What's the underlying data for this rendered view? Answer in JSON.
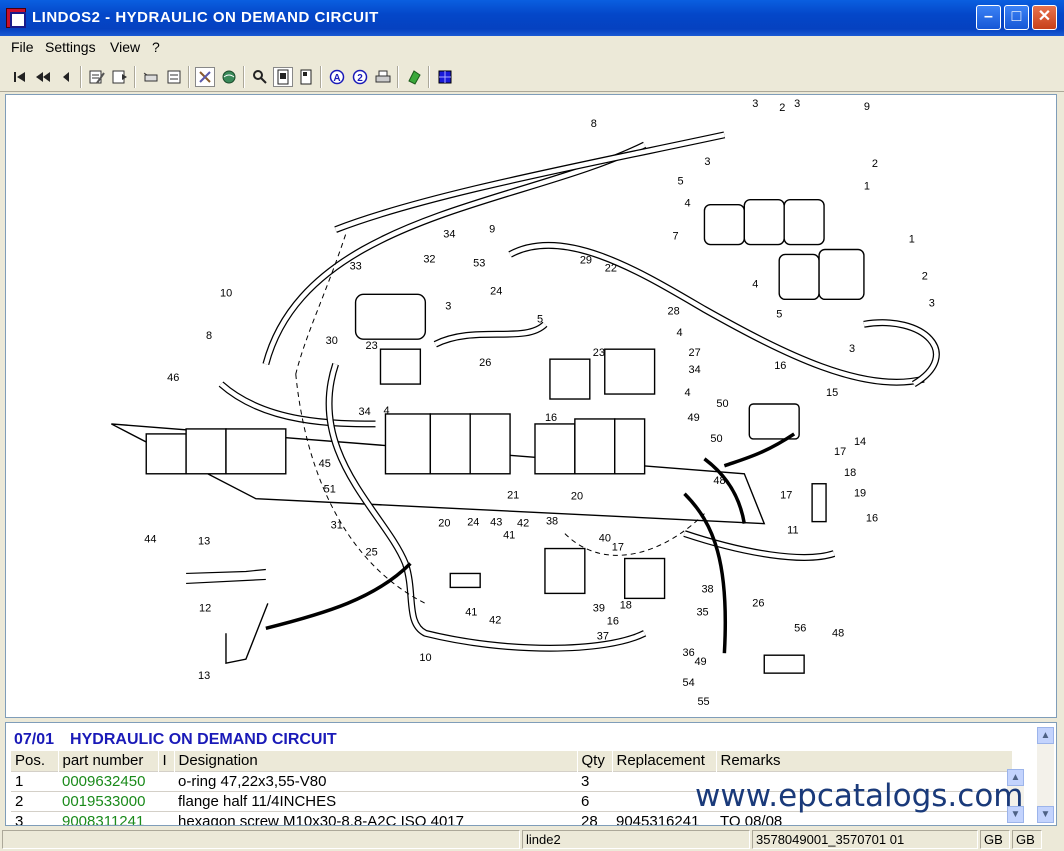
{
  "window": {
    "title": "LINDOS2 - HYDRAULIC ON DEMAND CIRCUIT",
    "minimize": "–",
    "maximize": "□",
    "close": "✕"
  },
  "menu": [
    {
      "label": "File"
    },
    {
      "label": "Settings"
    },
    {
      "label": "View"
    },
    {
      "label": "?"
    }
  ],
  "toolbar_icons": [
    "first-page-icon",
    "previous-page-icon",
    "back-icon",
    "edit-icon",
    "compare-icon",
    "cart-icon",
    "list-icon",
    "tools-icon",
    "globe-icon",
    "zoom-icon",
    "page-icon",
    "page-view-icon",
    "a-marker-icon",
    "number-marker-icon",
    "print-icon",
    "export-icon",
    "grid-icon"
  ],
  "drawing_labels": [
    "1",
    "2",
    "3",
    "4",
    "5",
    "7",
    "8",
    "9",
    "10",
    "11",
    "12",
    "13",
    "14",
    "15",
    "16",
    "17",
    "18",
    "19",
    "20",
    "21",
    "22",
    "23",
    "24",
    "25",
    "26",
    "27",
    "28",
    "29",
    "30",
    "31",
    "32",
    "33",
    "34",
    "35",
    "36",
    "37",
    "38",
    "39",
    "40",
    "41",
    "42",
    "43",
    "44",
    "45",
    "46",
    "48",
    "49",
    "50",
    "51",
    "53",
    "54",
    "55",
    "56"
  ],
  "parts": {
    "code": "07/01",
    "title": "HYDRAULIC ON DEMAND CIRCUIT",
    "columns": [
      "Pos.",
      "part number",
      "I",
      "Designation",
      "Qty",
      "Replacement",
      "Remarks"
    ],
    "rows": [
      [
        "1",
        "0009632450",
        "",
        "o-ring  47,22x3,55-V80",
        "3",
        "",
        ""
      ],
      [
        "2",
        "0019533000",
        "",
        "flange half 11/4INCHES",
        "6",
        "",
        ""
      ],
      [
        "3",
        "9008311241",
        "",
        "hexagon screw  M10x30-8.8-A2C ISO 4017",
        "28",
        "9045316241",
        "TO 08/08"
      ]
    ]
  },
  "watermark": "www.epcatalogs.com",
  "status": {
    "blank": "",
    "model": "linde2",
    "ref": "3578049001_3570701 01",
    "lang1": "GB",
    "lang2": "GB"
  },
  "colors": {
    "title_blue": "#1a1ab8",
    "part_number_green": "#1a8a1a"
  }
}
